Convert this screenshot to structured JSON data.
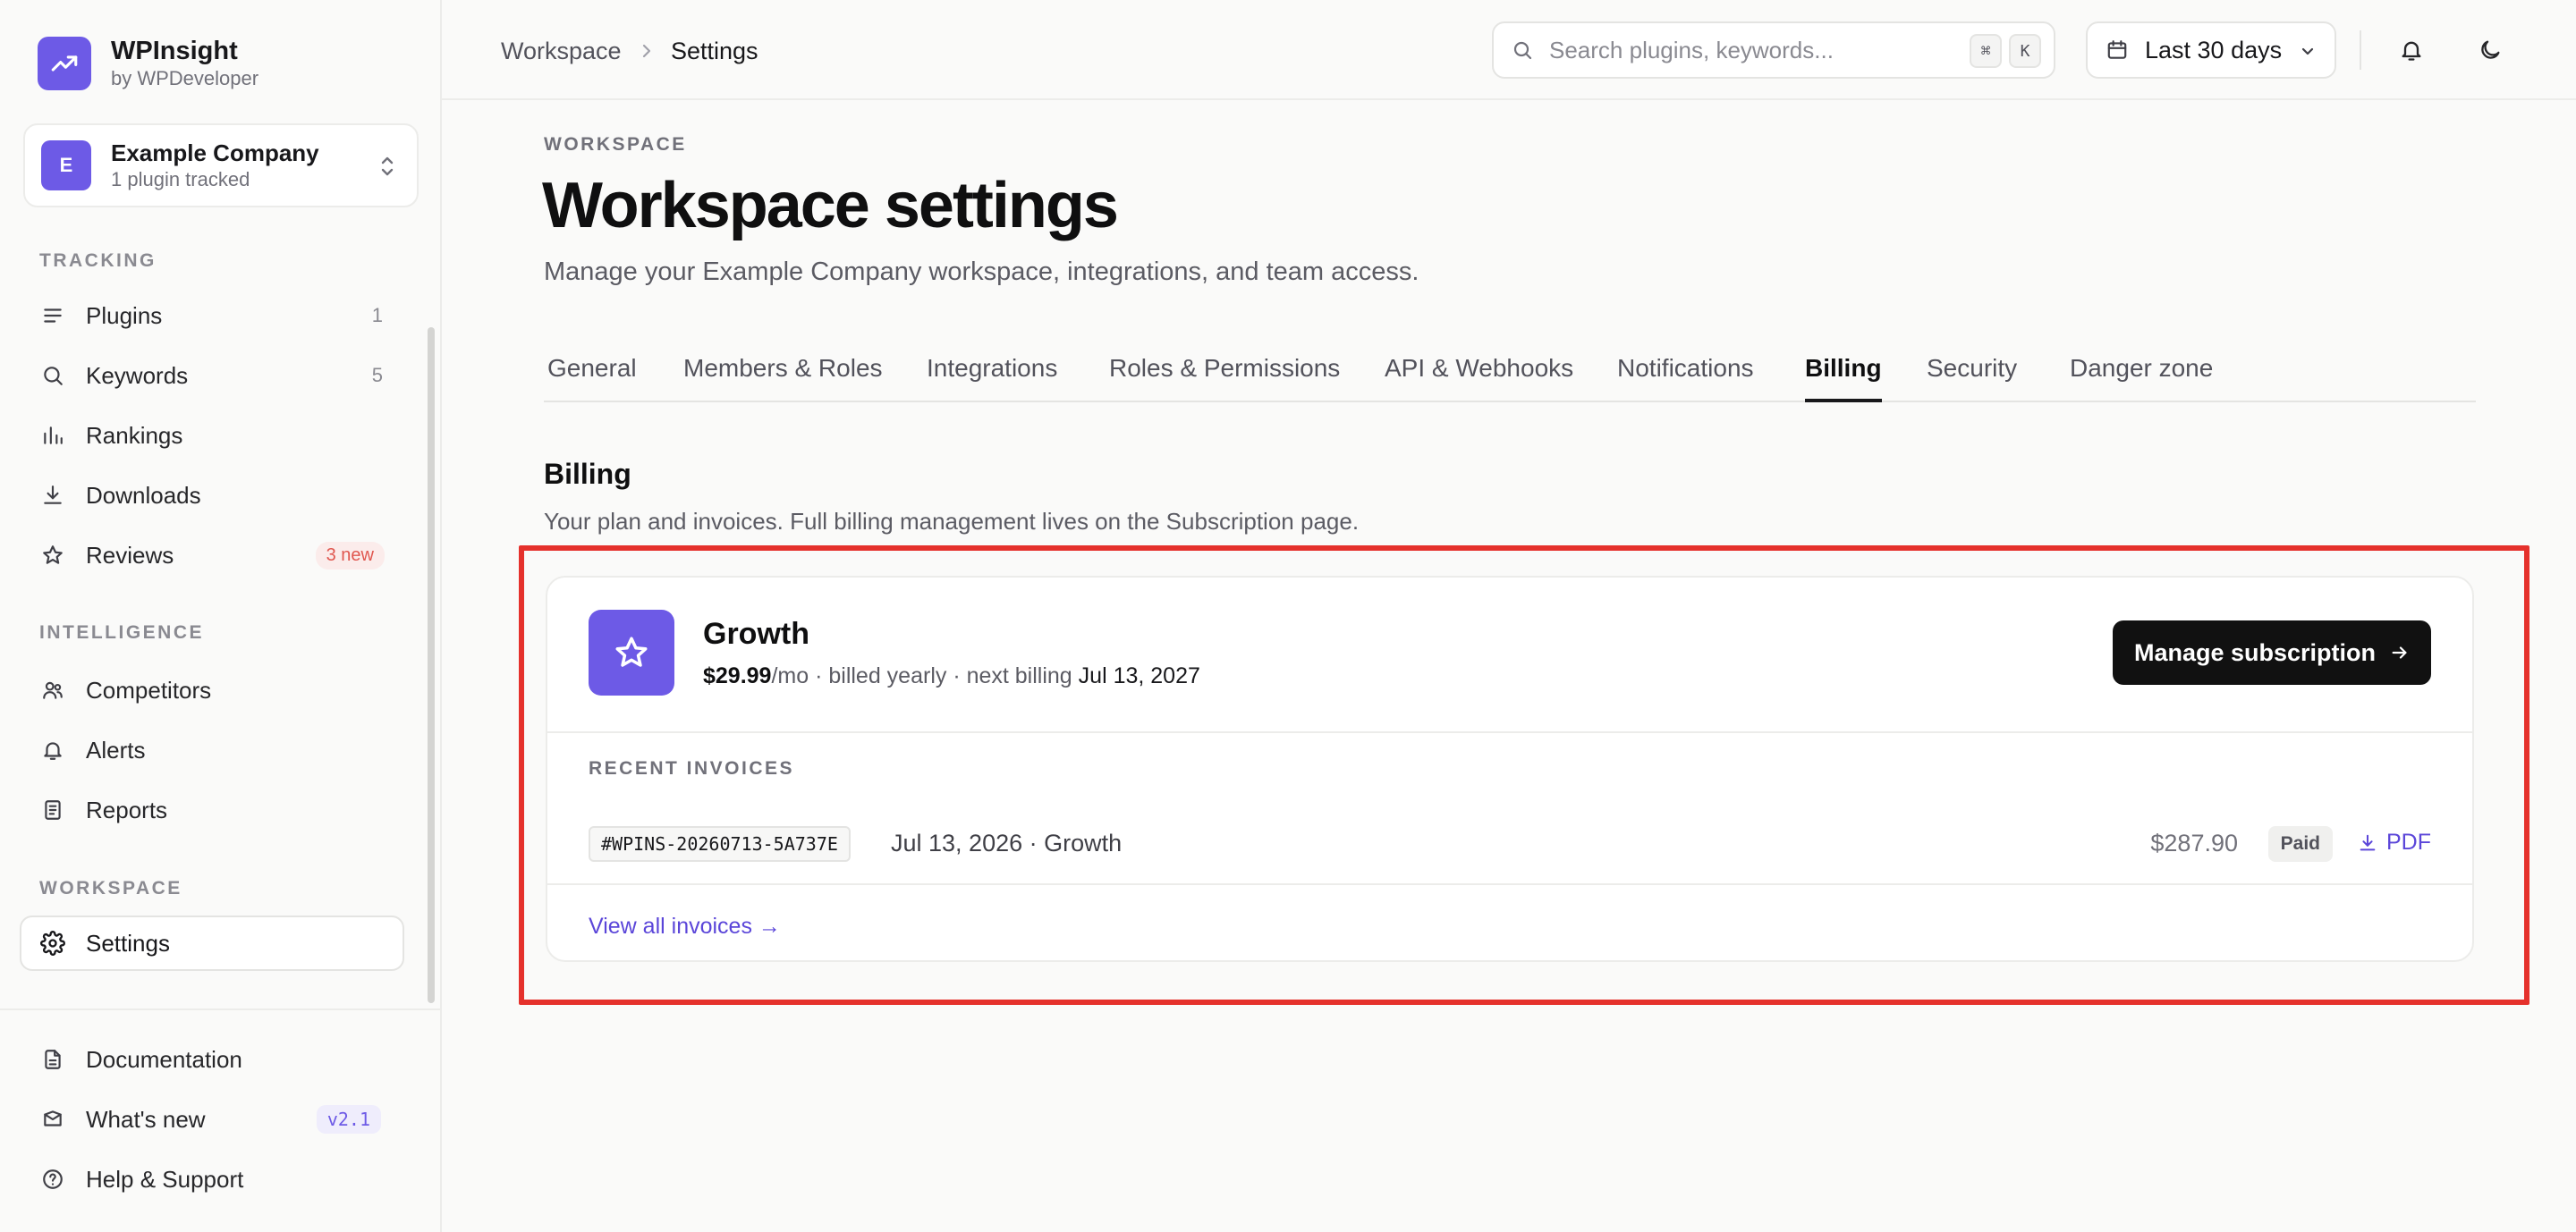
{
  "brand": {
    "name": "WPInsight",
    "sub": "by WPDeveloper"
  },
  "company": {
    "initial": "E",
    "name": "Example Company",
    "sub": "1 plugin tracked"
  },
  "sidebar": {
    "tracking_label": "TRACKING",
    "tracking": [
      {
        "label": "Plugins",
        "count": "1",
        "icon": "list-icon"
      },
      {
        "label": "Keywords",
        "count": "5",
        "icon": "search-icon"
      },
      {
        "label": "Rankings",
        "count": "",
        "icon": "bar-chart-icon"
      },
      {
        "label": "Downloads",
        "count": "",
        "icon": "download-icon"
      },
      {
        "label": "Reviews",
        "badge": "3 new",
        "icon": "star-icon"
      }
    ],
    "intelligence_label": "INTELLIGENCE",
    "intelligence": [
      {
        "label": "Competitors",
        "icon": "users-icon"
      },
      {
        "label": "Alerts",
        "icon": "bell-icon"
      },
      {
        "label": "Reports",
        "icon": "report-icon"
      }
    ],
    "workspace_label": "WORKSPACE",
    "workspace": [
      {
        "label": "Settings",
        "icon": "gear-icon",
        "active": true
      }
    ],
    "footer": [
      {
        "label": "Documentation",
        "icon": "document-icon"
      },
      {
        "label": "What's new",
        "badge": "v2.1",
        "icon": "gift-icon"
      },
      {
        "label": "Help & Support",
        "icon": "help-icon"
      }
    ]
  },
  "topbar": {
    "breadcrumb": [
      "Workspace",
      "Settings"
    ],
    "search_placeholder": "Search plugins, keywords...",
    "kbd": [
      "⌘",
      "K"
    ],
    "date_range": "Last 30 days"
  },
  "main": {
    "eyebrow": "WORKSPACE",
    "title": "Workspace settings",
    "description": "Manage your Example Company workspace, integrations, and team access.",
    "tabs": [
      {
        "label": "General"
      },
      {
        "label": "Members & Roles"
      },
      {
        "label": "Integrations"
      },
      {
        "label": "Roles & Permissions"
      },
      {
        "label": "API & Webhooks"
      },
      {
        "label": "Notifications"
      },
      {
        "label": "Billing",
        "active": true
      },
      {
        "label": "Security"
      },
      {
        "label": "Danger zone"
      }
    ],
    "billing": {
      "title": "Billing",
      "description": "Your plan and invoices. Full billing management lives on the Subscription page.",
      "plan": {
        "name": "Growth",
        "price": "$29.99",
        "period": "/mo · billed yearly · next billing ",
        "next_date": "Jul 13, 2027"
      },
      "manage_label": "Manage subscription",
      "invoices_label": "RECENT INVOICES",
      "invoices": [
        {
          "id": "#WPINS-20260713-5A737E",
          "date": "Jul 13, 2026 · Growth",
          "amount": "$287.90",
          "status": "Paid",
          "pdf": "PDF"
        }
      ],
      "view_all": "View all invoices →"
    }
  },
  "colors": {
    "accent": "#6d5ae6",
    "link": "#5b46d9",
    "highlight": "#e5312c",
    "badge_red": "#e0574f"
  }
}
